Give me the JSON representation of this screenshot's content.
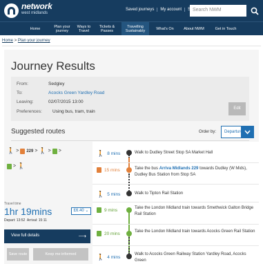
{
  "brand": {
    "name": "network",
    "sub": "west midlands"
  },
  "top_links": [
    "Saved journeys",
    "My account",
    "Sign out"
  ],
  "search": {
    "placeholder": "Search NWM"
  },
  "nav": [
    {
      "label": "Home"
    },
    {
      "label": "Plan your journey"
    },
    {
      "label": "Ways to Travel"
    },
    {
      "label": "Tickets & Passes"
    },
    {
      "label": "Travelling Sustainably"
    },
    {
      "label": "What's On"
    },
    {
      "label": "About NWM"
    },
    {
      "label": "Get in Touch"
    }
  ],
  "breadcrumb": {
    "home": "Home",
    "sep": ">",
    "current": "Plan your journey"
  },
  "page_title": "Journey Results",
  "journey": {
    "from_label": "From:",
    "from": "Sedgley",
    "to_label": "To:",
    "to": "Acocks Green Yardley Road",
    "leaving_label": "Leaving:",
    "leaving": "02/07/2015 13:00",
    "prefs_label": "Preferences:",
    "prefs": "Using bus, tram, train"
  },
  "edit_label": "Edit",
  "suggested": {
    "title": "Suggested routes",
    "order_label": "Order by:",
    "order_value": "Departure time"
  },
  "summary": {
    "bus_number": "229",
    "travel_time_label": "Travel time",
    "travel_time": "1hr 19mins",
    "fare": "£6.40",
    "depart_label": "Depart:",
    "depart": "13:52",
    "arrive_label": "Arrival:",
    "arrive": "15:11",
    "view_label": "View full details",
    "save_label": "Save route",
    "keep_label": "Keep me informed"
  },
  "legs": [
    {
      "mode": "walk",
      "duration": "8 mins",
      "pre": "Walk to Dudley Street Stop SA Market Hall",
      "highlight": "",
      "post": ""
    },
    {
      "mode": "bus",
      "duration": "15 mins",
      "pre": "Take the bus ",
      "highlight": "Arriva Midlands 229",
      "post": " towards Dudley (W Mids), Dudley Bus Station from Stop SA"
    },
    {
      "mode": "walk",
      "duration": "5 mins",
      "pre": "Walk to Tipton Rail Station",
      "highlight": "",
      "post": ""
    },
    {
      "mode": "train",
      "duration": "9 mins",
      "pre": "Take the London Midland train towards Smethwick Galton Bridge Rail Station",
      "highlight": "",
      "post": ""
    },
    {
      "mode": "train",
      "duration": "20 mins",
      "pre": "Take the London Midland train towards Acocks Green Rail Station",
      "highlight": "",
      "post": ""
    },
    {
      "mode": "walk",
      "duration": "4 mins",
      "pre": "Walk to Acocks Green Railway Station Yardley Road, Acocks Green",
      "highlight": "",
      "post": ""
    }
  ],
  "colors": {
    "navy": "#163c5f",
    "blue": "#1f6fb2",
    "bus": "#e2803a",
    "train": "#6fb03f"
  }
}
